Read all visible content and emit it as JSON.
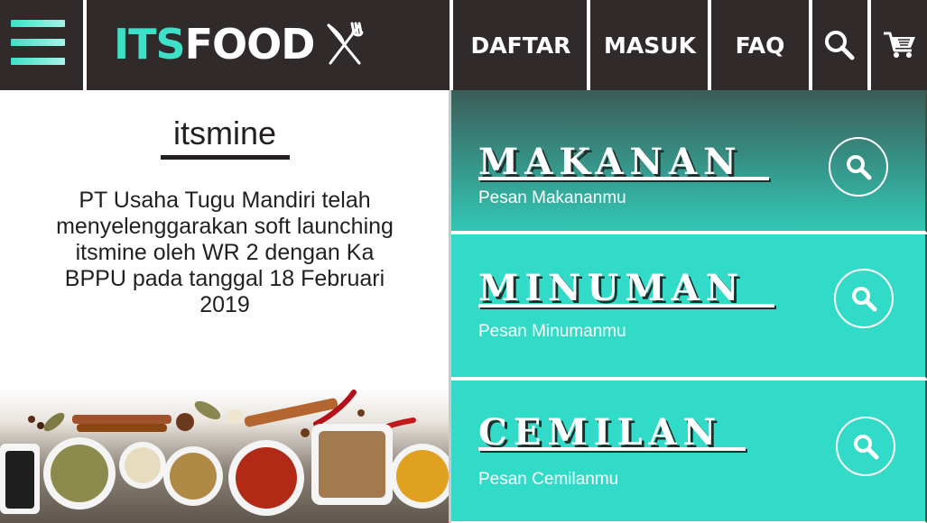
{
  "header": {
    "brand_its": "ITS",
    "brand_food": "FOOD",
    "nav": {
      "daftar": "DAFTAR",
      "masuk": "MASUK",
      "faq": "FAQ"
    },
    "icons": [
      "hamburger-menu-icon",
      "fork-knife-icon",
      "search-icon",
      "cart-icon"
    ]
  },
  "news": {
    "title": "itsmine",
    "body": "PT Usaha Tugu Mandiri telah menyelenggarakan soft launching itsmine oleh WR 2 dengan Ka BPPU pada tanggal 18 Februari 2019"
  },
  "categories": [
    {
      "title": "MAKANAN",
      "subtitle": "Pesan Makananmu"
    },
    {
      "title": "MINUMAN",
      "subtitle": "Pesan Minumanmu"
    },
    {
      "title": "CEMILAN",
      "subtitle": "Pesan Cemilanmu"
    }
  ],
  "colors": {
    "header_bg": "#312a2a",
    "accent": "#3fe0c8",
    "panel_teal": "#31dbc7",
    "panel_dark": "#3b5c57"
  }
}
